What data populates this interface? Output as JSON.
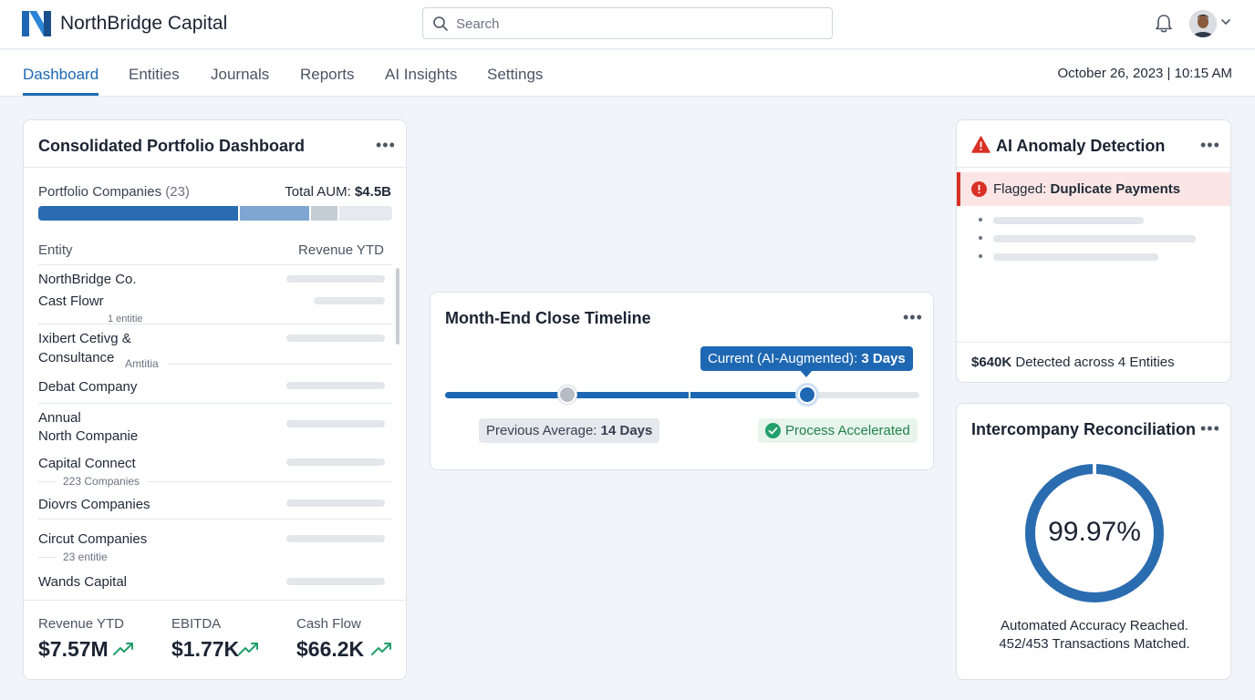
{
  "app": {
    "brand": "NorthBridge Capital"
  },
  "search": {
    "placeholder": "Search"
  },
  "nav": {
    "tabs": [
      "Dashboard",
      "Entities",
      "Journals",
      "Reports",
      "AI Insights",
      "Settings"
    ],
    "active": "Dashboard",
    "datetime": "October 26, 2023 | 10:15 AM"
  },
  "portfolio": {
    "title": "Consolidated Portfolio Dashboard",
    "companies_label": "Portfolio Companies",
    "companies_count": "(23)",
    "aum_label": "Total AUM:",
    "aum_value": "$4.5B",
    "col_entity": "Entity",
    "col_revenue": "Revenue YTD",
    "rows": [
      {
        "name": "NorthBridge Co."
      },
      {
        "name": "Cast Flowr",
        "sub": "1 entitie"
      },
      {
        "name": "Ixibert Cetivg &",
        "name2": "Consultance",
        "sub": "Amtitia"
      },
      {
        "name": "Debat Company"
      },
      {
        "name": "Annual",
        "name2": "North Companie"
      },
      {
        "name": "Capital Connect",
        "sub": "223 Companies"
      },
      {
        "name": "Diovrs Companies"
      },
      {
        "name": "Circut Companies",
        "sub": "23 entitie"
      },
      {
        "name": "Wands Capital"
      }
    ],
    "kpis": [
      {
        "label": "Revenue YTD",
        "value": "$7.57M"
      },
      {
        "label": "EBITDA",
        "value": "$1.77K"
      },
      {
        "label": "Cash Flow",
        "value": "$66.2K"
      }
    ],
    "colors": {
      "primary": "#2a6cb0",
      "secondary": "#7ea6d1",
      "tertiary": "#c4ccd6",
      "rest": "#e6e9ed"
    },
    "segments": [
      0.57,
      0.2,
      0.08,
      0.15
    ]
  },
  "timeline": {
    "title": "Month-End Close Timeline",
    "current_label": "Current (AI-Augmented):",
    "current_value": "3 Days",
    "previous_label": "Previous Average:",
    "previous_value": "14 Days",
    "status": "Process Accelerated"
  },
  "anomaly": {
    "title": "AI Anomaly Detection",
    "flag_label": "Flagged:",
    "flag_value": "Duplicate Payments",
    "summary_value": "$640K",
    "summary_text": "Detected across 4 Entities"
  },
  "recon": {
    "title": "Intercompany Reconciliation",
    "percent": "99.97%",
    "percent_value": 0.9997,
    "line1": "Automated Accuracy Reached.",
    "line2": "452/453 Transactions Matched.",
    "color": "#2a6cb0"
  }
}
